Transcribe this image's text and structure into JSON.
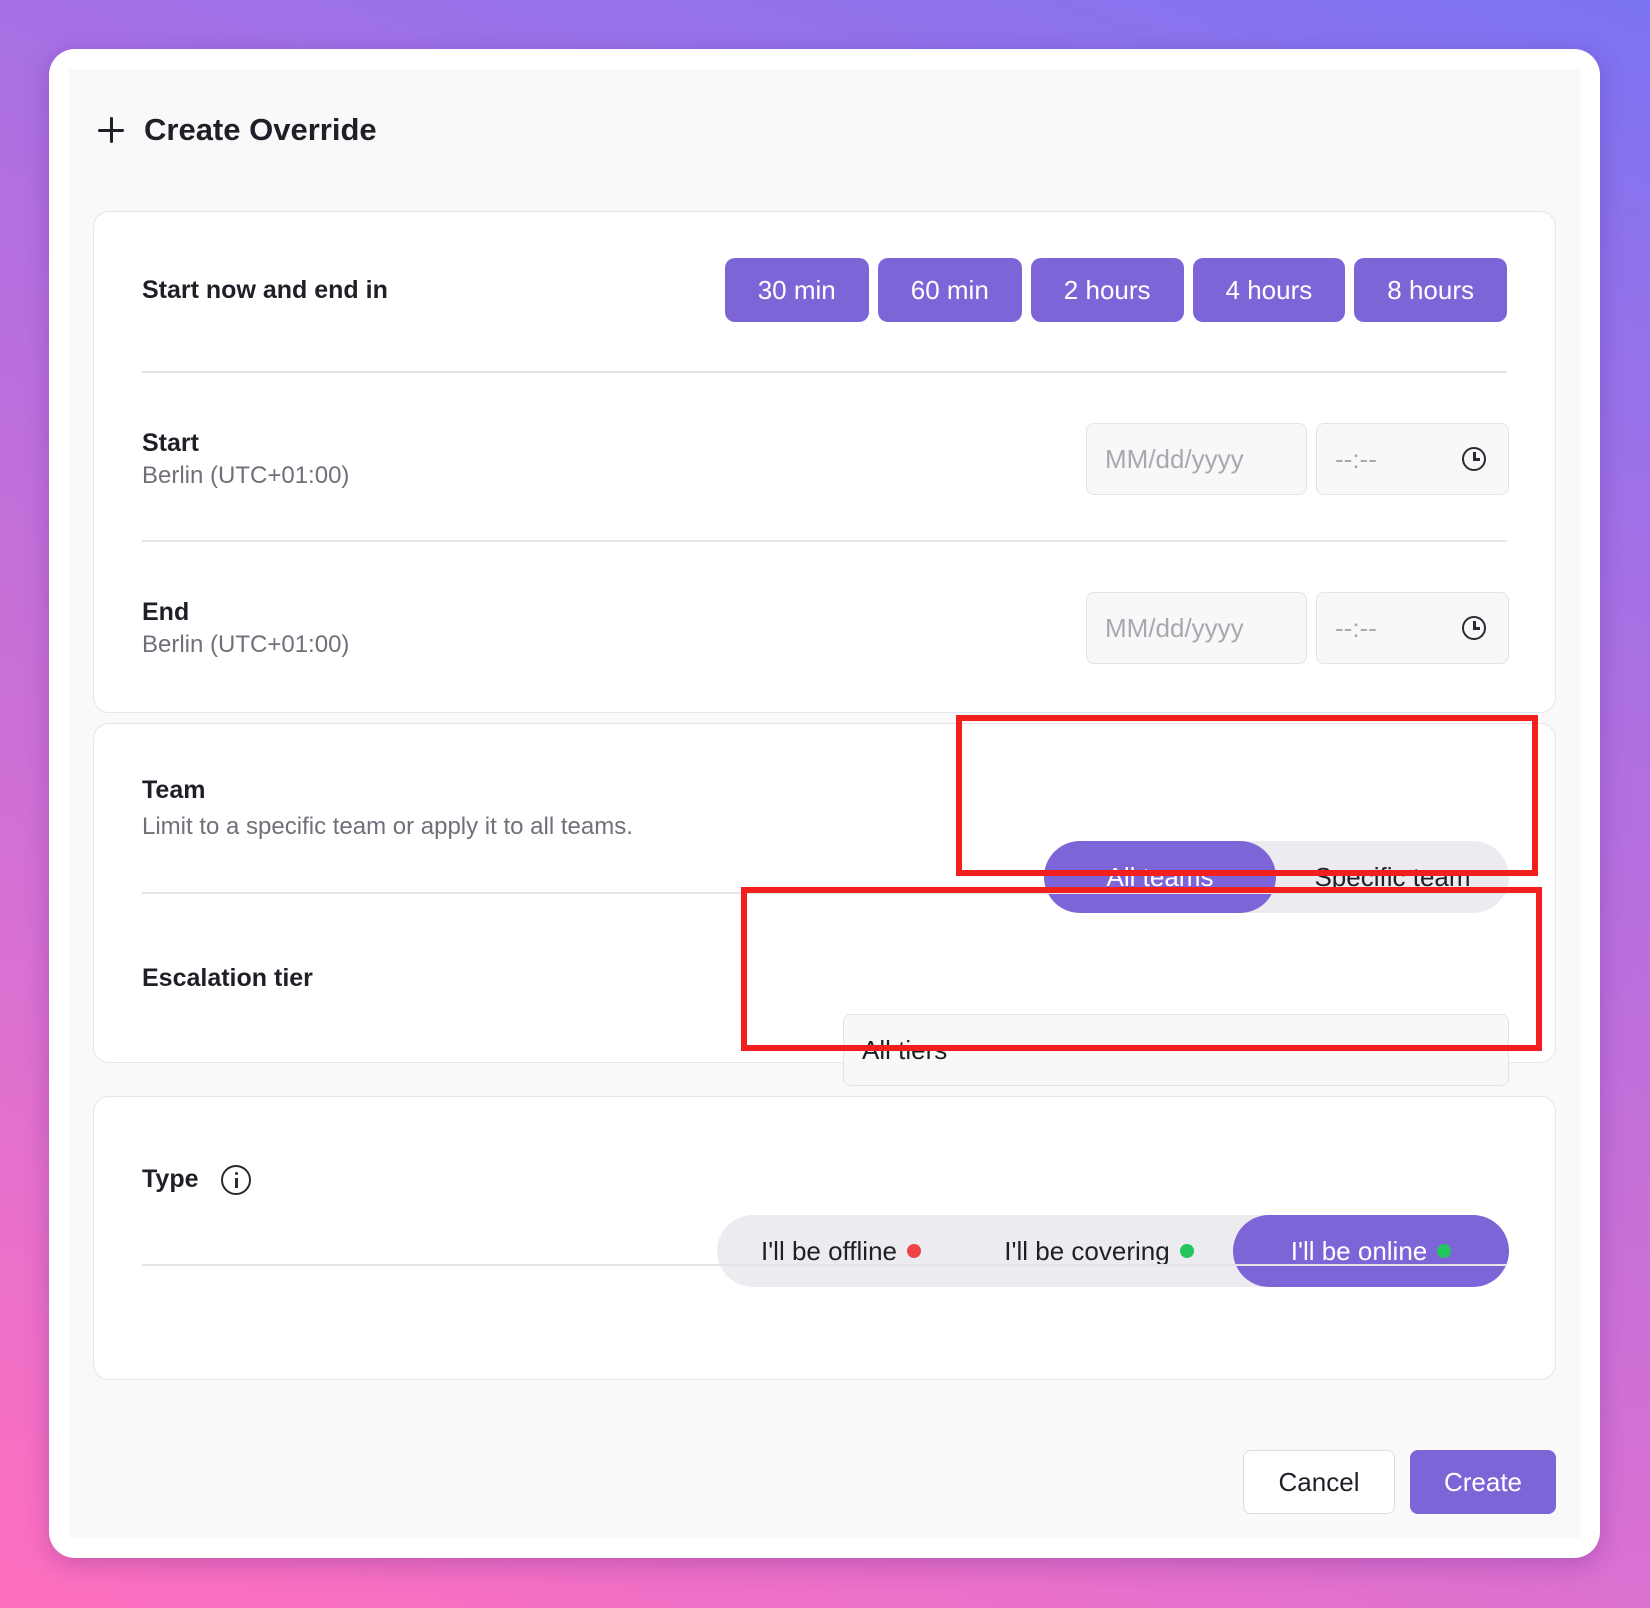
{
  "dialog": {
    "title": "Create Override"
  },
  "duration": {
    "label": "Start now and end in",
    "options": [
      "30 min",
      "60 min",
      "2 hours",
      "4 hours",
      "8 hours"
    ]
  },
  "start": {
    "label": "Start",
    "timezone": "Berlin (UTC+01:00)",
    "date_placeholder": "MM/dd/yyyy",
    "time_placeholder": "--:--"
  },
  "end": {
    "label": "End",
    "timezone": "Berlin (UTC+01:00)",
    "date_placeholder": "MM/dd/yyyy",
    "time_placeholder": "--:--"
  },
  "team": {
    "label": "Team",
    "description": "Limit to a specific team or apply it to all teams.",
    "options": [
      "All teams",
      "Specific team"
    ],
    "selected": "All teams"
  },
  "escalation": {
    "label": "Escalation tier",
    "value": "All tiers"
  },
  "type": {
    "label": "Type",
    "options": [
      {
        "label": "I'll be offline",
        "dot_color": "#ef4444"
      },
      {
        "label": "I'll be covering",
        "dot_color": "#22c55e"
      },
      {
        "label": "I'll be online",
        "dot_color": "#22c55e"
      }
    ],
    "selected": "I'll be online"
  },
  "footer": {
    "cancel_label": "Cancel",
    "create_label": "Create"
  },
  "colors": {
    "accent": "#7e65d7",
    "highlight": "#f21f1f"
  }
}
